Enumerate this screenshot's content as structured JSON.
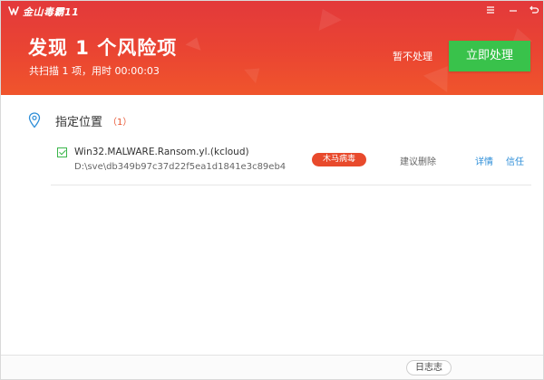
{
  "window": {
    "brand_name": "金山毒霸11",
    "menu_icon": "menu-icon",
    "minimize_icon": "minimize-icon",
    "close_icon": "close-icon"
  },
  "header": {
    "title": "发现 1 个风险项",
    "subtitle": "共扫描 1 项，用时 00:00:03",
    "ignore_label": "暂不处理",
    "fix_label": "立即处理",
    "colors": {
      "header_red": "#e3393b",
      "fix_green": "#39c24b"
    }
  },
  "section": {
    "icon": "location-pin-icon",
    "title": "指定位置",
    "count": "（1）"
  },
  "items": [
    {
      "name": "Win32.MALWARE.Ransom.yl.(kcloud)",
      "path": "D:\\sve\\db349b97c37d22f5ea1d1841e3c89eb4",
      "type_badge": "木马病毒",
      "advice": "建议删除",
      "detail_label": "详情",
      "trust_label": "信任",
      "checked": true
    }
  ],
  "footer": {
    "log_label": "日志志"
  }
}
